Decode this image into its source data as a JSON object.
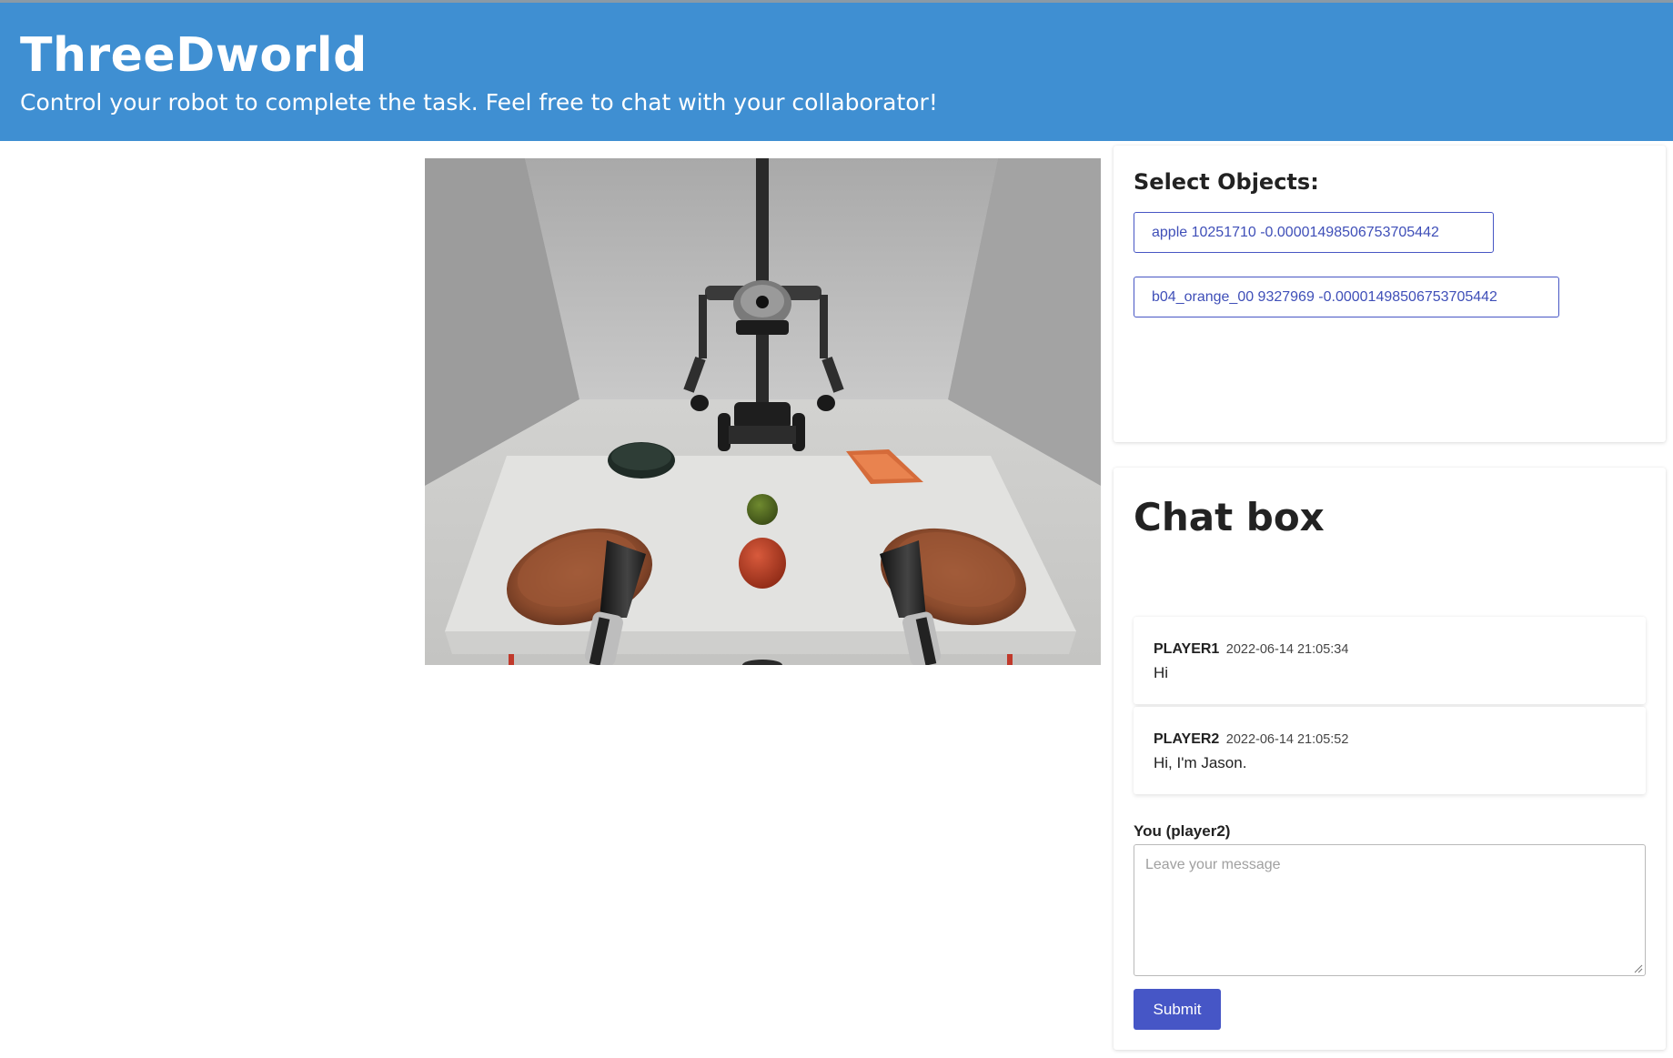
{
  "header": {
    "title": "ThreeDworld",
    "subtitle": "Control your robot to complete the task. Feel free to chat with your collaborator!"
  },
  "select_objects": {
    "heading": "Select Objects:",
    "options": [
      {
        "label": "apple 10251710 -0.00001498506753705442"
      },
      {
        "label": "b04_orange_00 9327969 -0.00001498506753705442"
      }
    ]
  },
  "chat": {
    "heading": "Chat box",
    "messages": [
      {
        "user": "PLAYER1",
        "time": "2022-06-14 21:05:34",
        "text": "Hi"
      },
      {
        "user": "PLAYER2",
        "time": "2022-06-14 21:05:52",
        "text": "Hi, I'm Jason."
      }
    ],
    "you_label": "You (player2)",
    "input_placeholder": "Leave your message",
    "input_value": "",
    "submit_label": "Submit"
  },
  "colors": {
    "header_bg": "#3f8fd2",
    "accent": "#4656c6"
  }
}
